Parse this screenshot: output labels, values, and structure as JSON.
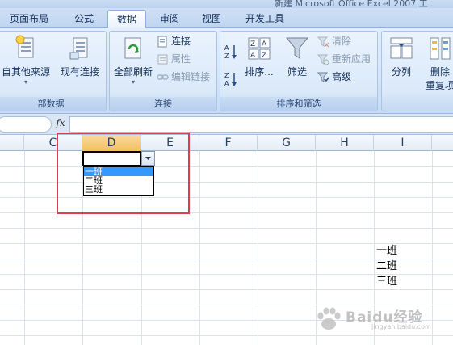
{
  "title_fragment": "新建 Microsoft Office Excel 2007 工",
  "tabs": [
    {
      "label": "页面布局"
    },
    {
      "label": "公式"
    },
    {
      "label": "数据",
      "active": true
    },
    {
      "label": "审阅"
    },
    {
      "label": "视图"
    },
    {
      "label": "开发工具"
    }
  ],
  "ribbon": {
    "get_external": {
      "other_sources": "自其他来源",
      "existing": "现有连接",
      "group_label": "部数据"
    },
    "connections": {
      "refresh_all": "全部刷新",
      "connections": "连接",
      "properties": "属性",
      "edit_links": "编辑链接",
      "group_label": "连接"
    },
    "sort_filter": {
      "sort": "排序...",
      "filter": "筛选",
      "clear": "清除",
      "reapply": "重新应用",
      "advanced": "高级",
      "group_label": "排序和筛选"
    },
    "data_tools": {
      "text_to_columns": "分列",
      "remove_dup_1": "删除",
      "remove_dup_2": "重复项"
    }
  },
  "formula_bar": {
    "fx": "fx",
    "value": ""
  },
  "columns": [
    "C",
    "D",
    "E",
    "F",
    "G",
    "H",
    "I"
  ],
  "selected_column": "D",
  "dropdown": {
    "options": [
      "一班",
      "二班",
      "三班"
    ],
    "highlighted_index": 0
  },
  "cells_i": [
    "一班",
    "二班",
    "三班"
  ],
  "watermark": {
    "big": "Baidu经验",
    "small": "jingyan.baidu.com"
  },
  "colors": {
    "selected_header": "#f1c15f",
    "highlight": "#3399ff",
    "annotation": "#d9404a"
  }
}
